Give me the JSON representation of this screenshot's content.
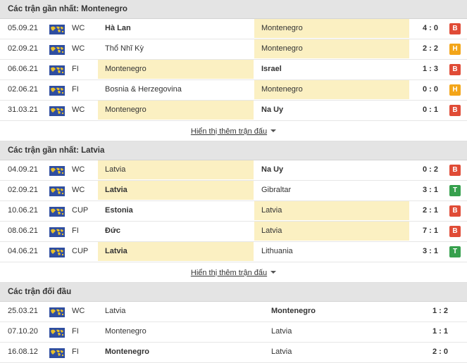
{
  "sections": [
    {
      "title": "Các trận gần nhất: Montenegro",
      "more": "Hiển thị thêm trận đấu",
      "rows": [
        {
          "date": "05.09.21",
          "comp": "WC",
          "home": "Hà Lan",
          "away": "Montenegro",
          "score": "4 : 0",
          "res": "B",
          "home_bold": true,
          "away_bold": false,
          "hl": "away"
        },
        {
          "date": "02.09.21",
          "comp": "WC",
          "home": "Thổ Nhĩ Kỳ",
          "away": "Montenegro",
          "score": "2 : 2",
          "res": "H",
          "home_bold": false,
          "away_bold": false,
          "hl": "away"
        },
        {
          "date": "06.06.21",
          "comp": "FI",
          "home": "Montenegro",
          "away": "Israel",
          "score": "1 : 3",
          "res": "B",
          "home_bold": false,
          "away_bold": true,
          "hl": "home"
        },
        {
          "date": "02.06.21",
          "comp": "FI",
          "home": "Bosnia & Herzegovina",
          "away": "Montenegro",
          "score": "0 : 0",
          "res": "H",
          "home_bold": false,
          "away_bold": false,
          "hl": "away"
        },
        {
          "date": "31.03.21",
          "comp": "WC",
          "home": "Montenegro",
          "away": "Na Uy",
          "score": "0 : 1",
          "res": "B",
          "home_bold": false,
          "away_bold": true,
          "hl": "home"
        }
      ]
    },
    {
      "title": "Các trận gần nhất: Latvia",
      "more": "Hiển thị thêm trận đấu",
      "rows": [
        {
          "date": "04.09.21",
          "comp": "WC",
          "home": "Latvia",
          "away": "Na Uy",
          "score": "0 : 2",
          "res": "B",
          "home_bold": false,
          "away_bold": true,
          "hl": "home"
        },
        {
          "date": "02.09.21",
          "comp": "WC",
          "home": "Latvia",
          "away": "Gibraltar",
          "score": "3 : 1",
          "res": "T",
          "home_bold": true,
          "away_bold": false,
          "hl": "home"
        },
        {
          "date": "10.06.21",
          "comp": "CUP",
          "home": "Estonia",
          "away": "Latvia",
          "score": "2 : 1",
          "res": "B",
          "home_bold": true,
          "away_bold": false,
          "hl": "away"
        },
        {
          "date": "08.06.21",
          "comp": "FI",
          "home": "Đức",
          "away": "Latvia",
          "score": "7 : 1",
          "res": "B",
          "home_bold": true,
          "away_bold": false,
          "hl": "away"
        },
        {
          "date": "04.06.21",
          "comp": "CUP",
          "home": "Latvia",
          "away": "Lithuania",
          "score": "3 : 1",
          "res": "T",
          "home_bold": true,
          "away_bold": false,
          "hl": "home"
        }
      ]
    }
  ],
  "h2h": {
    "title": "Các trận đối đầu",
    "rows": [
      {
        "date": "25.03.21",
        "comp": "WC",
        "home": "Latvia",
        "away": "Montenegro",
        "score": "1 : 2",
        "home_bold": false,
        "away_bold": true
      },
      {
        "date": "07.10.20",
        "comp": "FI",
        "home": "Montenegro",
        "away": "Latvia",
        "score": "1 : 1",
        "home_bold": false,
        "away_bold": false
      },
      {
        "date": "16.08.12",
        "comp": "FI",
        "home": "Montenegro",
        "away": "Latvia",
        "score": "2 : 0",
        "home_bold": true,
        "away_bold": false
      }
    ]
  },
  "colors": {
    "lose": "#e04b36",
    "draw": "#f3a519",
    "win": "#36a04d",
    "highlight": "#fbf0c2"
  },
  "icons": {
    "competition": "world-map-flag-icon",
    "more": "caret-down-icon"
  }
}
